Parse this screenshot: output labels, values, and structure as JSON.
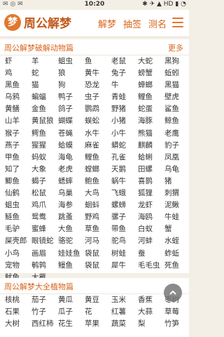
{
  "status_bar": {
    "left_icons": "✉ ◎ ✉",
    "time": "10:20",
    "right_icons": "✱ ✈ ▲ HD ▮ ◔"
  },
  "header": {
    "logo_char": "梦",
    "logo_text": "周公解梦",
    "nav": [
      "解梦",
      "抽签",
      "测名"
    ],
    "menu_icon": "hamburger-icon"
  },
  "animals": {
    "title": "周公解梦破解动物篇",
    "more": "更多",
    "items": [
      "虾",
      "羊",
      "蛆虫",
      "鱼",
      "老鼠",
      "大蛇",
      "黑狗",
      "鸡",
      "蛇",
      "狼",
      "黄牛",
      "兔子",
      "螃蟹",
      "蚯蚓",
      "黑鱼",
      "猫",
      "狗",
      "恐龙",
      "牛",
      "蟑螂",
      "黑猫",
      "乌鸦",
      "蝙蝠",
      "鸭子",
      "虫子",
      "青蛙",
      "鲤鱼",
      "壁虎",
      "黄鳝",
      "金鱼",
      "鸽子",
      "鹦鹉",
      "野猪",
      "蛇蛋",
      "鲨鱼",
      "山羊",
      "黄鼠狼",
      "蝴蝶",
      "蜈蚣",
      "小猪",
      "海豚",
      "鲸鱼",
      "猴子",
      "鳄鱼",
      "苍蝇",
      "水牛",
      "小牛",
      "熊猫",
      "老鹰",
      "燕子",
      "猩猩",
      "蛤蟆",
      "麻雀",
      "蟒蛇",
      "麒麟",
      "豹子",
      "甲鱼",
      "蚂蚁",
      "海龟",
      "鲤鱼",
      "孔雀",
      "蛤蜊",
      "凤凰",
      "知了",
      "大象",
      "老虎",
      "螳螂",
      "天鹅",
      "田螺",
      "乌龟",
      "鲫鱼",
      "蝎子",
      "蟋蟀",
      "鲍鱼",
      "蜗牛",
      "喜鹊",
      "猪",
      "仙鹤",
      "松鼠",
      "乌巢",
      "大鸟",
      "飞蛾",
      "狐狸",
      "刺猬",
      "蛆虫",
      "鸡爪",
      "海参",
      "蛔蚪",
      "螺蛳",
      "龙虾",
      "泥鳅",
      "鲢鱼",
      "鸳鸯",
      "跳蚤",
      "野鸡",
      "骡子",
      "海鸥",
      "牛蛙",
      "毛驴",
      "蜜蜂",
      "大鱼",
      "草鱼",
      "带鱼",
      "白蚁",
      "蟹",
      "屎壳郎",
      "眼镜蛇",
      "骆驼",
      "河马",
      "驼鸟",
      "河蚌",
      "水蛭",
      "小鸟",
      "画眉",
      "娃娃鱼",
      "袋鼠",
      "树蛙",
      "蚕",
      "蚱蚯",
      "宠物",
      "鹌鹑",
      "鳗鱼",
      "袋鼠",
      "犀牛",
      "毛毛虫",
      "死鱼",
      "鱿鱼",
      "大雁"
    ]
  },
  "plants": {
    "title": "周公解梦大全植物篇",
    "items": [
      "核桃",
      "茄子",
      "黄瓜",
      "黄豆",
      "玉米",
      "香蕉",
      "枣树",
      "石果",
      "竹子",
      "瓜子",
      "花",
      "红薯",
      "大蒜",
      "草莓",
      "大树",
      "西红柿",
      "花生",
      "苹果",
      "蔬菜",
      "梨",
      "竹笋"
    ]
  },
  "fab_icon": "chevron-up-icon"
}
